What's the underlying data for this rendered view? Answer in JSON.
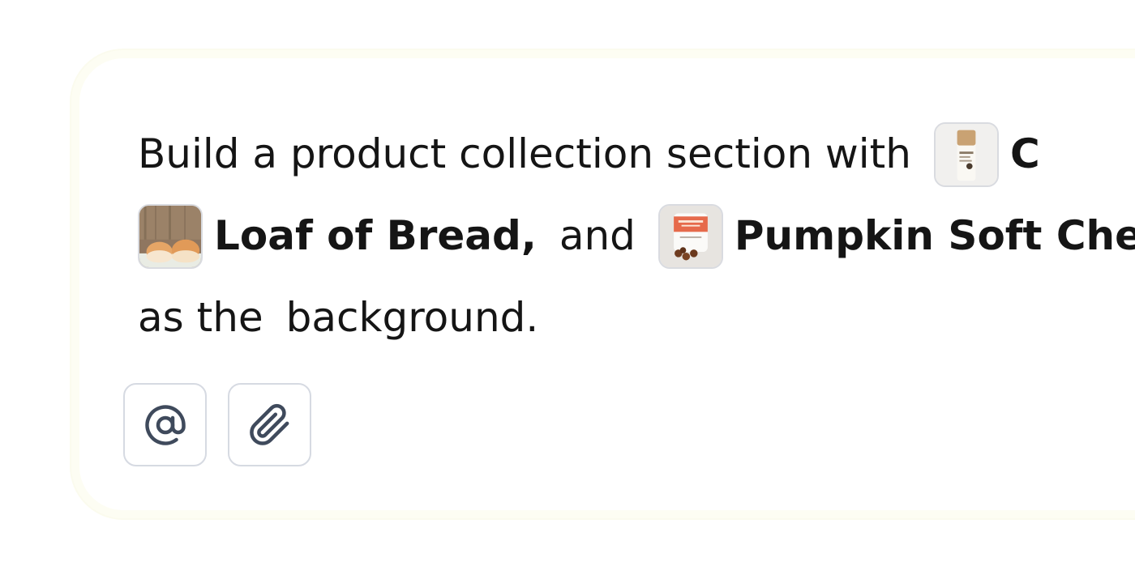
{
  "prompt": {
    "line1_text": "Build a product collection section with",
    "product1_label": "C",
    "product2_label": "Loaf of Bread,",
    "and_text": "and",
    "product3_label": "Pumpkin Soft Che",
    "line3_as_the": "as the",
    "line3_background": "background."
  },
  "products": [
    {
      "name": "C",
      "thumbnail_icon": "product-bottle-image"
    },
    {
      "name": "Loaf of Bread",
      "thumbnail_icon": "bread-image"
    },
    {
      "name": "Pumpkin Soft Che",
      "thumbnail_icon": "treat-jar-image"
    }
  ],
  "toolbar": {
    "mention_icon": "at-sign-icon",
    "attach_icon": "paperclip-icon"
  },
  "colors": {
    "text": "#151515",
    "border": "#d6dae2",
    "icon": "#3f4a5c",
    "composer_glow": "#fdfdf3"
  }
}
